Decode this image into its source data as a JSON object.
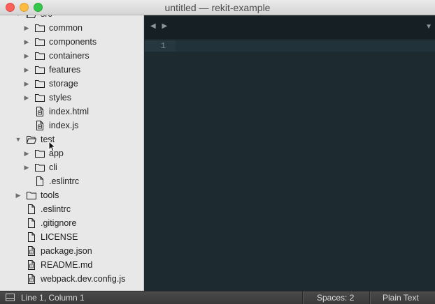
{
  "window": {
    "title": "untitled — rekit-example"
  },
  "sidebar": {
    "items": [
      {
        "label": "src",
        "type": "folder-open",
        "arrow": "▼",
        "level": 0
      },
      {
        "label": "common",
        "type": "folder",
        "arrow": "▶",
        "level": 1
      },
      {
        "label": "components",
        "type": "folder",
        "arrow": "▶",
        "level": 1
      },
      {
        "label": "containers",
        "type": "folder",
        "arrow": "▶",
        "level": 1
      },
      {
        "label": "features",
        "type": "folder",
        "arrow": "▶",
        "level": 1
      },
      {
        "label": "storage",
        "type": "folder",
        "arrow": "▶",
        "level": 1
      },
      {
        "label": "styles",
        "type": "folder",
        "arrow": "▶",
        "level": 1
      },
      {
        "label": "index.html",
        "type": "code-file",
        "arrow": "",
        "level": 1
      },
      {
        "label": "index.js",
        "type": "code-file",
        "arrow": "",
        "level": 1
      },
      {
        "label": "test",
        "type": "folder-open",
        "arrow": "▼",
        "level": 0
      },
      {
        "label": "app",
        "type": "folder",
        "arrow": "▶",
        "level": 1
      },
      {
        "label": "cli",
        "type": "folder",
        "arrow": "▶",
        "level": 1
      },
      {
        "label": ".eslintrc",
        "type": "file",
        "arrow": "",
        "level": 1
      },
      {
        "label": "tools",
        "type": "folder",
        "arrow": "▶",
        "level": 0
      },
      {
        "label": ".eslintrc",
        "type": "file",
        "arrow": "",
        "level": 0
      },
      {
        "label": ".gitignore",
        "type": "file",
        "arrow": "",
        "level": 0
      },
      {
        "label": "LICENSE",
        "type": "file",
        "arrow": "",
        "level": 0
      },
      {
        "label": "package.json",
        "type": "code-file",
        "arrow": "",
        "level": 0
      },
      {
        "label": "README.md",
        "type": "code-file",
        "arrow": "",
        "level": 0
      },
      {
        "label": "webpack.dev.config.js",
        "type": "code-file",
        "arrow": "",
        "level": 0
      }
    ]
  },
  "tabbar": {
    "nav_label": "◀ ▶",
    "dropdown_label": "▼"
  },
  "editor": {
    "line_numbers": [
      "1"
    ]
  },
  "statusbar": {
    "cursor_position": "Line 1, Column 1",
    "indentation": "Spaces: 2",
    "syntax": "Plain Text"
  }
}
